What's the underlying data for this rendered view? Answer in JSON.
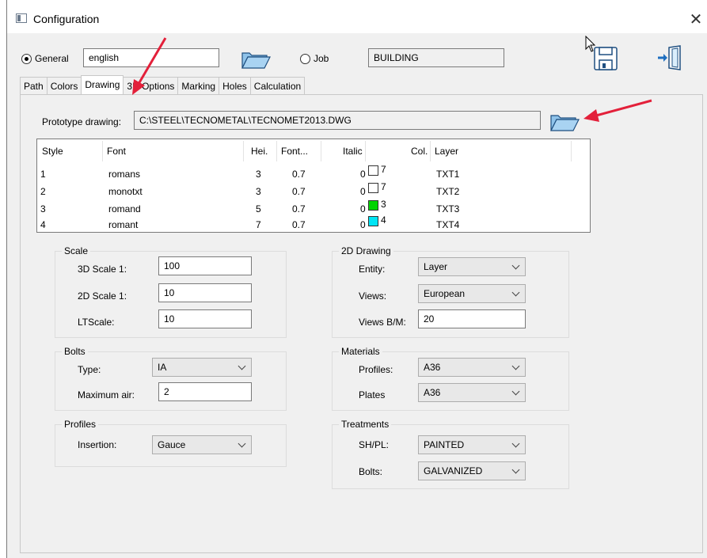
{
  "window": {
    "title": "Configuration"
  },
  "top": {
    "general_label": "General",
    "language_value": "english",
    "job_label": "Job",
    "job_value": "BUILDING"
  },
  "tabs": [
    {
      "label": "Path"
    },
    {
      "label": "Colors"
    },
    {
      "label": "Drawing"
    },
    {
      "label": "3D Options"
    },
    {
      "label": "Marking"
    },
    {
      "label": "Holes"
    },
    {
      "label": "Calculation"
    }
  ],
  "prototype": {
    "label": "Prototype drawing:",
    "value": "C:\\STEEL\\TECNOMETAL\\TECNOMET2013.DWG"
  },
  "table": {
    "headers": {
      "style": "Style",
      "font": "Font",
      "hei": "Hei.",
      "fontw": "Font...",
      "italic": "Italic",
      "col": "Col.",
      "layer": "Layer"
    },
    "rows": [
      {
        "style": "1",
        "font": "romans",
        "hei": "3",
        "fontw": "0.7",
        "italic": "0",
        "color": "#ffffff",
        "col": "7",
        "layer": "TXT1"
      },
      {
        "style": "2",
        "font": "monotxt",
        "hei": "3",
        "fontw": "0.7",
        "italic": "0",
        "color": "#ffffff",
        "col": "7",
        "layer": "TXT2"
      },
      {
        "style": "3",
        "font": "romand",
        "hei": "5",
        "fontw": "0.7",
        "italic": "0",
        "color": "#00d400",
        "col": "3",
        "layer": "TXT3"
      },
      {
        "style": "4",
        "font": "romant",
        "hei": "7",
        "fontw": "0.7",
        "italic": "0",
        "color": "#00e5f5",
        "col": "4",
        "layer": "TXT4"
      }
    ]
  },
  "scale": {
    "title": "Scale",
    "s3d_label": "3D Scale 1:",
    "s3d_value": "100",
    "s2d_label": "2D Scale 1:",
    "s2d_value": "10",
    "lt_label": "LTScale:",
    "lt_value": "10"
  },
  "drawing2d": {
    "title": "2D Drawing",
    "entity_label": "Entity:",
    "entity_value": "Layer",
    "views_label": "Views:",
    "views_value": "European",
    "viewsbm_label": "Views B/M:",
    "viewsbm_value": "20"
  },
  "bolts": {
    "title": "Bolts",
    "type_label": "Type:",
    "type_value": "IA",
    "maxair_label": "Maximum air:",
    "maxair_value": "2"
  },
  "materials": {
    "title": "Materials",
    "profiles_label": "Profiles:",
    "profiles_value": "A36",
    "plates_label": "Plates",
    "plates_value": "A36"
  },
  "profiles": {
    "title": "Profiles",
    "insertion_label": "Insertion:",
    "insertion_value": "Gauce"
  },
  "treatments": {
    "title": "Treatments",
    "shpl_label": "SH/PL:",
    "shpl_value": "PAINTED",
    "bolts_label": "Bolts:",
    "bolts_value": "GALVANIZED"
  },
  "colors": {
    "arrow": "#e3203a",
    "folder": "#8fc3ea"
  }
}
